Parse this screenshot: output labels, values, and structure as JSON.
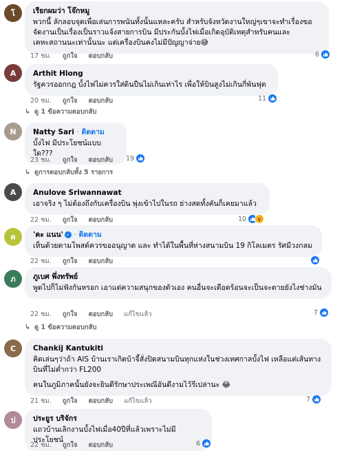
{
  "comments": [
    {
      "name": "เรียกผมว่า โจ๊กหมู",
      "paragraphs": [
        "พวกนี้ ลักลอบจุดเพื่อเล่นการพนันทั้งนั้นแหละครับ สำหรับจังหวัดงานใหญ่ๆเขาจะทำเรื่องขอจัดงานเป็นเรื่องเป็นราวแจ้งสายการบิน มีประกันบั้งไฟเมื่อเกิดอุบัติเหตุสำหรับคนและเคหะสถานนะเท่านั้นนะ แต่เครื่องบินคงไม่มีปัญญาจ่าย😅"
      ],
      "time": "17 ชม.",
      "like_label": "ถูกใจ",
      "reply_label": "ตอบกลับ",
      "reaction_count": "6"
    },
    {
      "name": "Arthit Hlong",
      "paragraphs": [
        "รัฐควรออกกฎ บั้งไฟไม่ควรใส่ดินปืนไม่เกินเท่าไร เพื่อให้บินสูงไม่เกินกี่พันฟุต"
      ],
      "time": "20 ชม.",
      "like_label": "ถูกใจ",
      "reply_label": "ตอบกลับ",
      "reaction_count": "11",
      "replies_text": "ดู 1 ข้อความตอบกลับ"
    },
    {
      "name": "Natty Sari",
      "follow": "ติดตาม",
      "paragraphs": [
        "บั้งไฟ มีประโยชน์แบบใด???"
      ],
      "time": "23 ชม.",
      "like_label": "ถูกใจ",
      "reply_label": "ตอบกลับ",
      "reaction_count": "19",
      "replies_text": "ดูการตอบกลับทั้ง 5 รายการ"
    },
    {
      "name": "Anulove Sriwannawat",
      "paragraphs": [
        "เอาจริง ๆ ไม่ต้องถึงกับเครื่องบิน พุ่งเข้าไปในรถ ย่างสดทั้งคันก็เคยมาแล้ว"
      ],
      "time": "22 ชม.",
      "like_label": "ถูกใจ",
      "reply_label": "ตอบกลับ",
      "reaction_count": "10"
    },
    {
      "name": "'คะ แนน'",
      "follow": "ติดตาม",
      "paragraphs": [
        "เห็นด้วยตามโพสต์ควรขออนุญาต และ ทำได้ในพื้นที่ห่างสนามบิน 19 กิโลเมตร รัศมีวงกลม"
      ],
      "time": "22 ชม.",
      "like_label": "ถูกใจ",
      "reply_label": "ตอบกลับ"
    },
    {
      "name": "ภูเบศ พึ่งทรัพย์",
      "paragraphs": [
        "พูดไปก็ไม่ฟังกันหรอก เอาแต่ความสนุกของตัวเอง คนอื่นจะเดือดร้อนจะเป็นจะตายยังไงช่างมัน"
      ],
      "time": "22 ชม.",
      "like_label": "ถูกใจ",
      "reply_label": "ตอบกลับ",
      "edited_label": "แก้ไขแล้ว",
      "reaction_count": "7",
      "replies_text": "ดู 1 ข้อความตอบกลับ"
    },
    {
      "name": "Chankij Kantukiti",
      "paragraphs": [
        "คิดเล่นๆว่าถ้า AIS บ้านเราเกิดบ้าจี้สั่งปิดสนามบินทุกแห่งในช่วงเทศกาลบั้งไฟ เหลือแต่เส้นทางบินที่ไม่ต่ำกว่า FL200",
        "คนในภูมิภาคนั้นยังจะยินดีรักษาประเพณีอันดีงามไว้รึเปล่านะ 😂"
      ],
      "time": "21 ชม.",
      "like_label": "ถูกใจ",
      "reply_label": "ตอบกลับ",
      "edited_label": "แก้ไขแล้ว",
      "reaction_count": "7"
    },
    {
      "name": "ประยูร บริจักร",
      "paragraphs": [
        "แถวบ้านเลิกงานบั้งไฟเมื่อ40ปีที่แล้วเพราะไม่มีประโยชน์"
      ],
      "time": "22 ชม.",
      "like_label": "ถูกใจ",
      "reply_label": "ตอบกลับ",
      "reaction_count": "6"
    }
  ],
  "colors": {
    "link": "#1877f2",
    "muted": "#65676b",
    "bubble": "#f0f2f5"
  }
}
